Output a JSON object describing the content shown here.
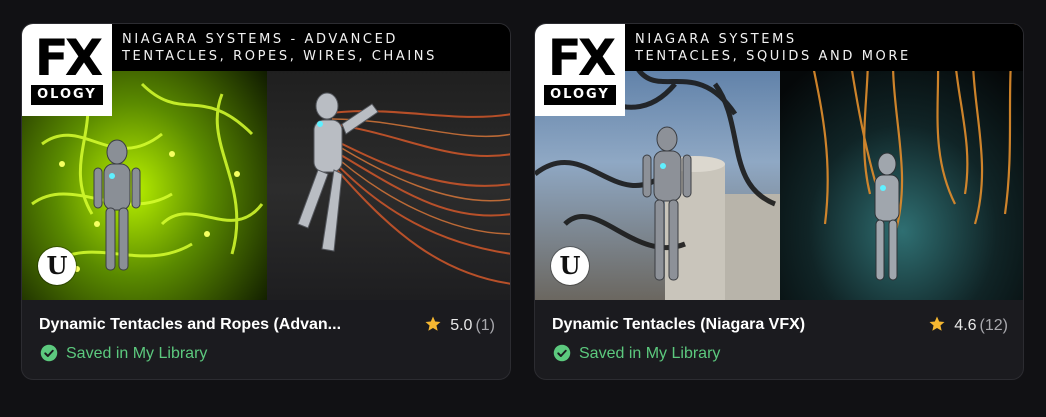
{
  "colors": {
    "background": "#111114",
    "card": "#1b1b1f",
    "saved_green": "#5cc97e",
    "star_gold": "#f5b731"
  },
  "cards": [
    {
      "banner_line1": "NIAGARA SYSTEMS - ADVANCED",
      "banner_line2": "TENTACLES, ROPES, WIRES, CHAINS",
      "logo_top": "FX",
      "logo_bottom": "OLOGY",
      "badge_icon": "unreal-engine-icon",
      "title": "Dynamic Tentacles and Ropes (Advan...",
      "rating": "5.0",
      "rating_count": "(1)",
      "saved_label": "Saved in My Library"
    },
    {
      "banner_line1": "NIAGARA SYSTEMS",
      "banner_line2": "TENTACLES, SQUIDS AND MORE",
      "logo_top": "FX",
      "logo_bottom": "OLOGY",
      "badge_icon": "unreal-engine-icon",
      "title": "Dynamic Tentacles (Niagara VFX)",
      "rating": "4.6",
      "rating_count": "(12)",
      "saved_label": "Saved in My Library"
    }
  ]
}
